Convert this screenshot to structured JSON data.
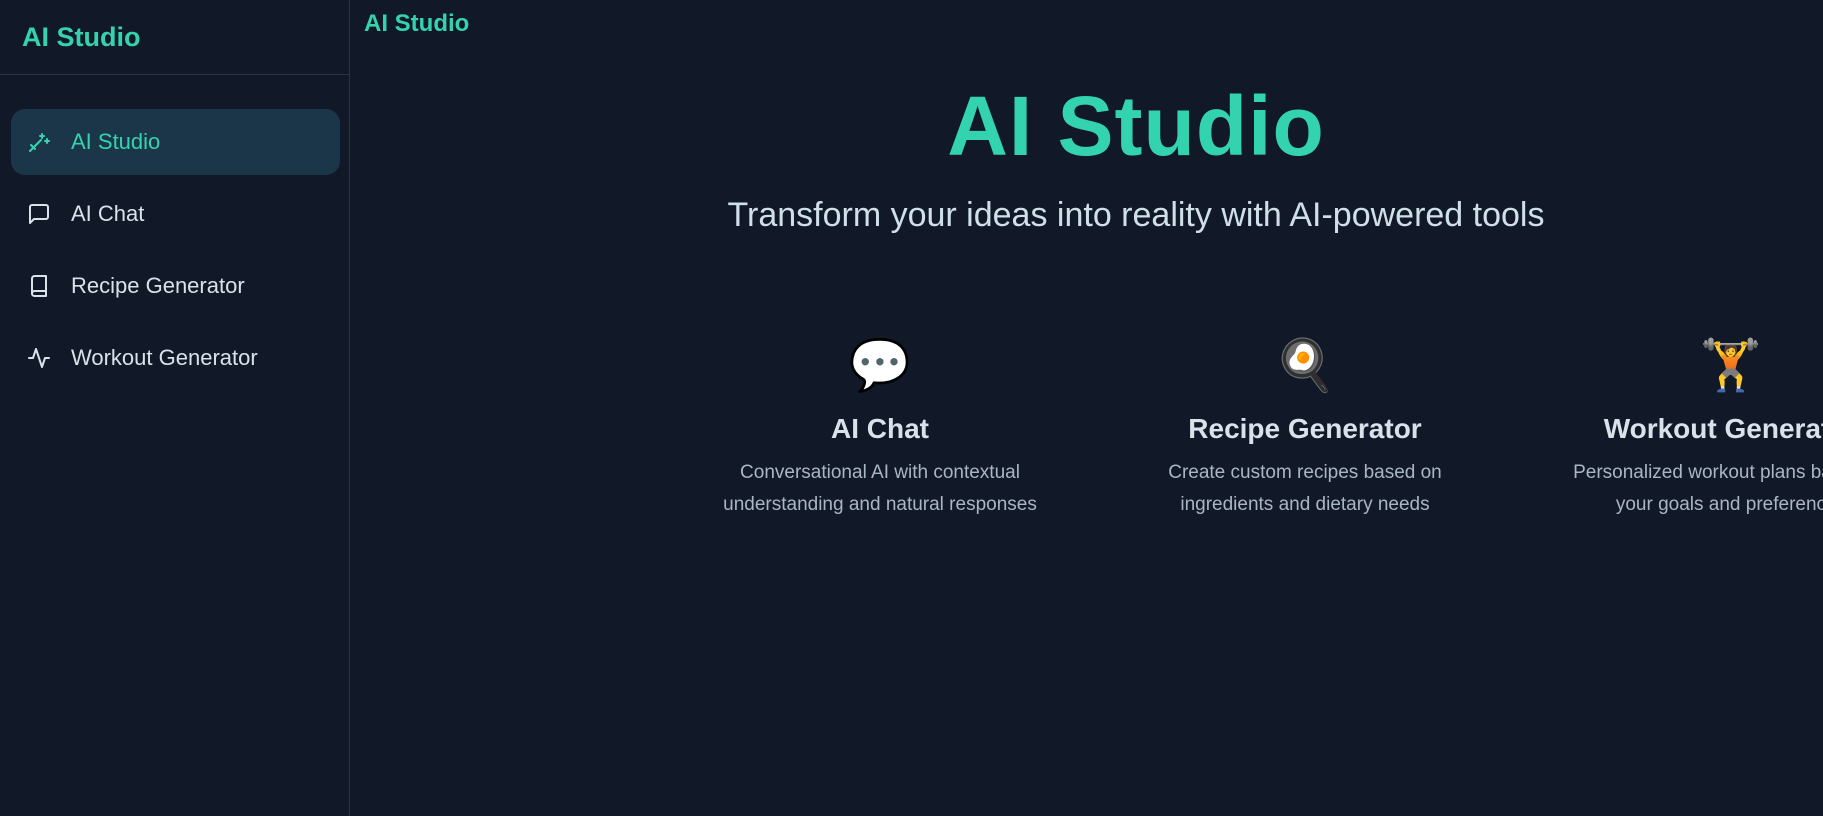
{
  "sidebar": {
    "title": "AI Studio",
    "items": [
      {
        "label": "AI Studio",
        "icon": "magic-wand-icon",
        "active": true
      },
      {
        "label": "AI Chat",
        "icon": "chat-bubble-icon",
        "active": false
      },
      {
        "label": "Recipe Generator",
        "icon": "book-icon",
        "active": false
      },
      {
        "label": "Workout Generator",
        "icon": "activity-pulse-icon",
        "active": false
      }
    ]
  },
  "topbar": {
    "title": "AI Studio"
  },
  "hero": {
    "title": "AI Studio",
    "subtitle": "Transform your ideas into reality with AI-powered tools"
  },
  "cards": [
    {
      "emoji": "💬",
      "title": "AI Chat",
      "description": "Conversational AI with contextual understanding and natural responses"
    },
    {
      "emoji": "🍳",
      "title": "Recipe Generator",
      "description": "Create custom recipes based on ingredients and dietary needs"
    },
    {
      "emoji": "🏋️",
      "title": "Workout Generator",
      "description": "Personalized workout plans based on your goals and preferences"
    }
  ],
  "colors": {
    "background": "#111827",
    "accent": "#34d3b0",
    "active_nav_bg": "#1c3649",
    "text_primary": "#d9e1ea",
    "text_muted": "#a9b6c3"
  }
}
